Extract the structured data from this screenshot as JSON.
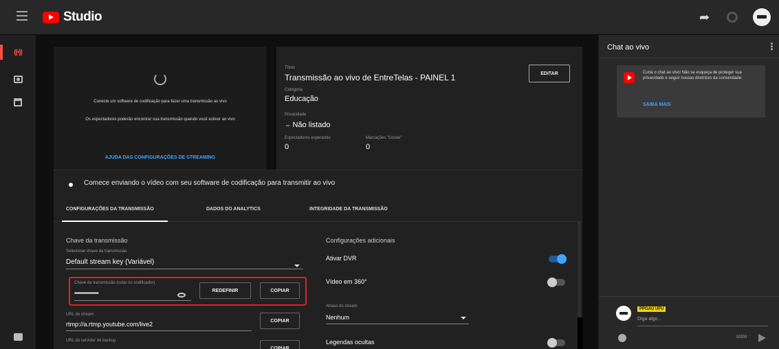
{
  "header": {
    "app_name": "Studio",
    "icons": [
      "menu-icon",
      "youtube-logo",
      "share-icon",
      "gear-icon",
      "avatar"
    ]
  },
  "nav": {
    "items": [
      {
        "icon": "live-icon",
        "label": "((•))",
        "active": true
      },
      {
        "icon": "camera-icon"
      },
      {
        "icon": "calendar-icon"
      },
      {
        "icon": "feedback-icon"
      }
    ]
  },
  "preview": {
    "message": "Conecte um software de codificação para fazer uma transmissão ao vivo",
    "sub_message": "Os espectadores poderão encontrar sua transmissão quando você estiver ao vivo",
    "help_link": "AJUDA DAS CONFIGURAÇÕES DE STREAMING"
  },
  "stream_info": {
    "title_label": "Título",
    "title": "Transmissão ao vivo de EntreTelas - PAINEL 1",
    "category_label": "Categoria",
    "category": "Educação",
    "privacy_label": "Privacidade",
    "privacy": "Não listado",
    "waiting_label": "Espectadores esperando",
    "waiting": "0",
    "likes_label": "Marcações \"Gostei\"",
    "likes": "0",
    "edit_button": "EDITAR"
  },
  "banner": {
    "text": "Comece enviando o vídeo com seu software de codificação para transmitir ao vivo"
  },
  "tabs": [
    {
      "label": "CONFIGURAÇÕES DA TRANSMISSÃO",
      "active": true
    },
    {
      "label": "DADOS DO ANALYTICS",
      "active": false
    },
    {
      "label": "INTEGRIDADE DA TRANSMISSÃO",
      "active": false
    }
  ],
  "settings": {
    "stream_key_heading": "Chave da transmissão",
    "key_select_label": "Selecionar chave da transmissão",
    "key_select_value": "Default stream key (Variável)",
    "key_field_label": "Chave de transmissão (colar no codificador)",
    "key_field_value": "••••••••••••••••••••••••",
    "reset_button": "REDEFINIR",
    "copy_button": "COPIAR",
    "url_label": "URL do stream",
    "url_value": "rtmp://a.rtmp.youtube.com/live2",
    "backup_label": "URL do servidor de backup",
    "additional_heading": "Configurações adicionais",
    "dvr_label": "Ativar DVR",
    "dvr_on": true,
    "video360_label": "Vídeo em 360°",
    "video360_on": false,
    "delay_label": "Atraso do stream",
    "delay_value": "Nenhum",
    "captions_label": "Legendas ocultas",
    "captions_on": false
  },
  "chat": {
    "title": "Chat ao vivo",
    "welcome": "Curta o chat ao vivo! Não se esqueça de proteger sua privacidade e seguir nossas diretrizes da comunidade.",
    "learn_more": "SAIBA MAIS",
    "username": "PPGAU UFU",
    "placeholder": "Diga algo...",
    "char_count": "0/200"
  },
  "colors": {
    "accent": "#3ea6ff",
    "brand": "#ff0000",
    "highlight_border": "#e02020",
    "username_badge": "#f1d01b"
  }
}
